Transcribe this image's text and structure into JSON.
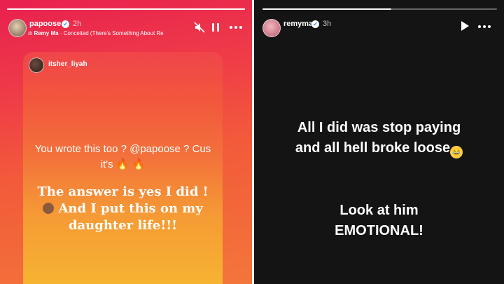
{
  "left_story": {
    "username": "papoose",
    "time": "2h",
    "music": {
      "artist": "Remy Ma",
      "separator": " · ",
      "title": "Conceited (There's Something About Re"
    },
    "progress": 1.0,
    "shared_post": {
      "username": "itsher_liyah",
      "question_part1": "You wrote this too ? ",
      "question_mention": "@papoose",
      "question_part2": " ? Cus",
      "question_line2": "it's",
      "answer_line1": "The answer is yes I did !",
      "answer_line2": " And I put this on my",
      "answer_line3": "daughter life!!!"
    }
  },
  "right_story": {
    "username": "remyma",
    "time": "3h",
    "progress": 0.55,
    "text_line1": "All I did was stop paying",
    "text_line2": "and all hell broke loose",
    "text_line3": "Look at him",
    "text_line4": "EMOTIONAL!"
  },
  "icons": {
    "mute": "speaker-muted-icon",
    "pause": "pause-icon",
    "play": "play-icon",
    "more": "more-horizontal-icon",
    "verified": "verified-badge-icon",
    "music": "music-bars-icon",
    "fire": "fire-emoji",
    "laugh": "laughing-emoji"
  },
  "colors": {
    "left_bg_top": "#e8204f",
    "left_bg_bottom": "#f3763a",
    "right_bg": "#141414",
    "verified": "#2b7cff"
  }
}
